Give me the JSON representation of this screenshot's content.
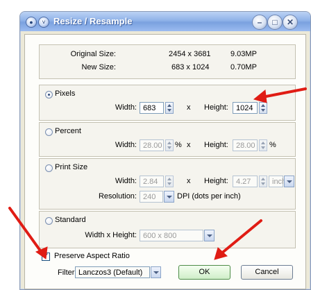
{
  "window": {
    "title": "Resize / Resample"
  },
  "info": {
    "original_label": "Original Size:",
    "original_dims": "2454 x 3681",
    "original_mp": "9.03MP",
    "new_label": "New Size:",
    "new_dims": "683 x 1024",
    "new_mp": "0.70MP"
  },
  "pixels": {
    "label": "Pixels",
    "width_label": "Width:",
    "width_value": "683",
    "x_label": "x",
    "height_label": "Height:",
    "height_value": "1024"
  },
  "percent": {
    "label": "Percent",
    "width_label": "Width:",
    "width_value": "28.00",
    "width_unit": "%",
    "x_label": "x",
    "height_label": "Height:",
    "height_value": "28.00",
    "height_unit": "%"
  },
  "print_size": {
    "label": "Print Size",
    "width_label": "Width:",
    "width_value": "2.84",
    "x_label": "x",
    "height_label": "Height:",
    "height_value": "4.27",
    "unit_value": "inch",
    "resolution_label": "Resolution:",
    "resolution_value": "240",
    "dpi_label": "DPI (dots per inch)"
  },
  "standard": {
    "label": "Standard",
    "wh_label": "Width x Height:",
    "wh_value": "600 x 800"
  },
  "options": {
    "preserve_label": "Preserve Aspect Ratio",
    "preserve_checked": "✓",
    "filter_label": "Filter:",
    "filter_value": "Lanczos3 (Default)"
  },
  "buttons": {
    "ok": "OK",
    "cancel": "Cancel"
  },
  "colors": {
    "annotation_arrow": "#e01c14"
  }
}
